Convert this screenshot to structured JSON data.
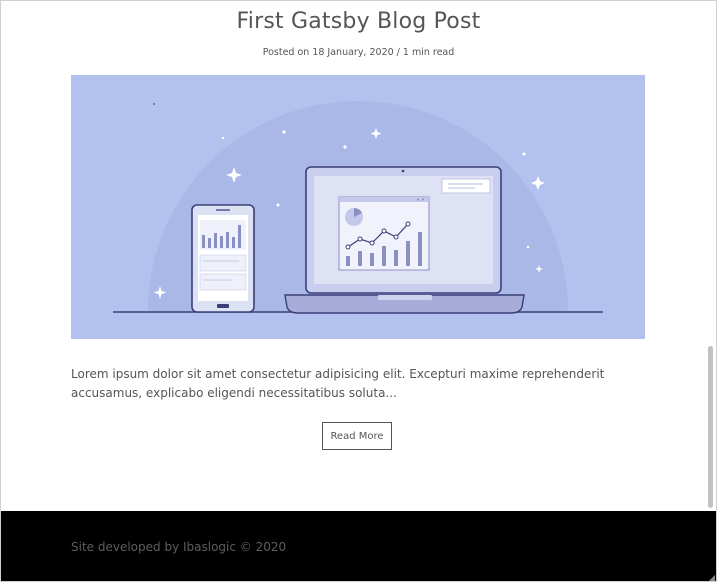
{
  "post": {
    "title": "First Gatsby Blog Post",
    "meta": "Posted on 18 January, 2020 / 1 min read",
    "image_alt": "laptop and phone analytics illustration",
    "excerpt": "Lorem ipsum dolor sit amet consectetur adipisicing elit. Excepturi maxime reprehenderit accusamus, explicabo eligendi necessitatibus soluta...",
    "read_more_label": "Read More"
  },
  "footer": {
    "text": "Site developed by Ibaslogic © 2020"
  },
  "colors": {
    "hero_bg": "#b3c1ee",
    "footer_bg": "#000000",
    "text": "#555555"
  }
}
